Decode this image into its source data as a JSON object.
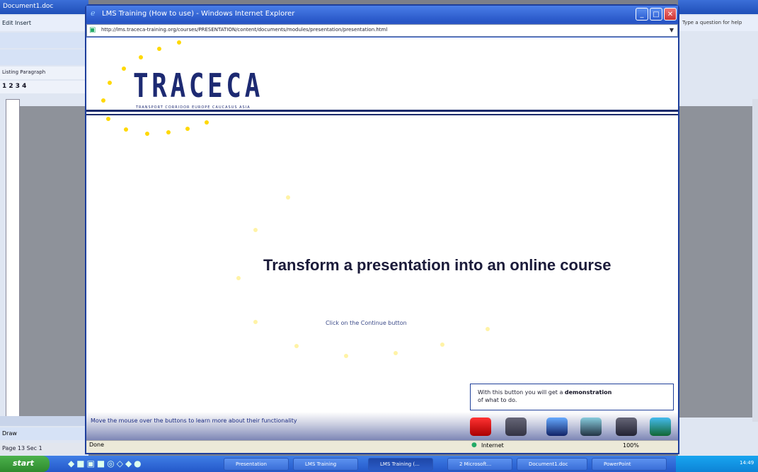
{
  "ie": {
    "title": "LMS Training (How to use) - Windows Internet Explorer",
    "address": "http://lms.traceca-training.org/courses/PRESENTATION/content/documents/modules/presentation/presentation.html",
    "status_left": "Done",
    "status_zone": "Internet",
    "status_zoom": "100%"
  },
  "page": {
    "logo": "TRACECA",
    "logo_tagline": "TRANSPORT CORRIDOR EUROPE CAUCASUS ASIA",
    "headline": "Transform a presentation into an online course",
    "subline": "Click on the Continue button",
    "tooltip_prefix": "With this button you will get a",
    "tooltip_bold": "demonstration",
    "tooltip_suffix": "of what to do.",
    "nav_help": "Move the mouse over the buttons to learn more about their functionality"
  },
  "word": {
    "title": "Document1.doc",
    "menu": "Edit  Insert",
    "style": "Listing Paragraph",
    "outline": "1  2  3  4",
    "draw": "Draw",
    "status": "Page 13   Sec 1"
  },
  "right_window": {
    "toolbar_text": "Type a question for help"
  },
  "taskbar": {
    "start": "start",
    "tasks": [
      "Presentation",
      "LMS Training",
      "LMS Training (...",
      "2 Microsoft...",
      "Document1.doc",
      "PowerPoint"
    ],
    "tray_time": "14:49"
  },
  "colors": {
    "accent": "#1d2a72",
    "star": "#ffd800",
    "ie_blue": "#2c57c7"
  }
}
